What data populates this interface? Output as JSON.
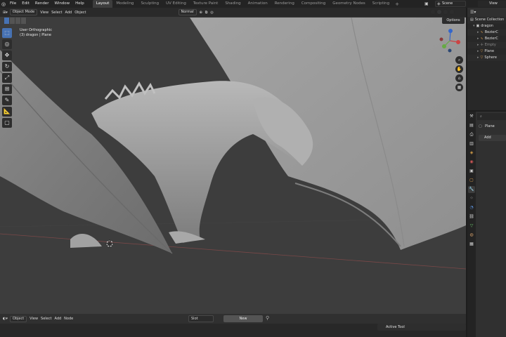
{
  "menu": [
    "File",
    "Edit",
    "Render",
    "Window",
    "Help"
  ],
  "workspaces": [
    {
      "label": "Layout",
      "active": true
    },
    {
      "label": "Modeling",
      "active": false
    },
    {
      "label": "Sculpting",
      "active": false
    },
    {
      "label": "UV Editing",
      "active": false
    },
    {
      "label": "Texture Paint",
      "active": false
    },
    {
      "label": "Shading",
      "active": false
    },
    {
      "label": "Animation",
      "active": false
    },
    {
      "label": "Rendering",
      "active": false
    },
    {
      "label": "Compositing",
      "active": false
    },
    {
      "label": "Geometry Nodes",
      "active": false
    },
    {
      "label": "Scripting",
      "active": false
    }
  ],
  "scene": {
    "name": "Scene",
    "view_layer": "View"
  },
  "viewport": {
    "mode": "Object Mode",
    "menu": [
      "View",
      "Select",
      "Add",
      "Object"
    ],
    "orientation": "Normal",
    "options_label": "Options",
    "info_line1": "User Orthographic",
    "info_line2": "(3) dragon | Plane"
  },
  "bottom": {
    "mode": "Object",
    "menu": [
      "View",
      "Select",
      "Add",
      "Node"
    ],
    "slot": "Slot",
    "new_label": "New",
    "active_tool": "Active Tool"
  },
  "outliner": {
    "rows": [
      {
        "label": "Scene Collection",
        "icon": "collection-icon"
      },
      {
        "label": "dragon",
        "icon": "collection-icon"
      },
      {
        "label": "BezierC",
        "icon": "curve-icon"
      },
      {
        "label": "BezierC",
        "icon": "curve-icon"
      },
      {
        "label": "Empty",
        "icon": "empty-icon"
      },
      {
        "label": "Plane",
        "icon": "mesh-icon"
      },
      {
        "label": "Sphere",
        "icon": "mesh-icon"
      }
    ]
  },
  "properties": {
    "object_name": "Plane",
    "add_label": "Add"
  },
  "colors": {
    "accent": "#4772b3",
    "viewport_bg": "#3d3d3d",
    "panel_bg": "#303030"
  }
}
